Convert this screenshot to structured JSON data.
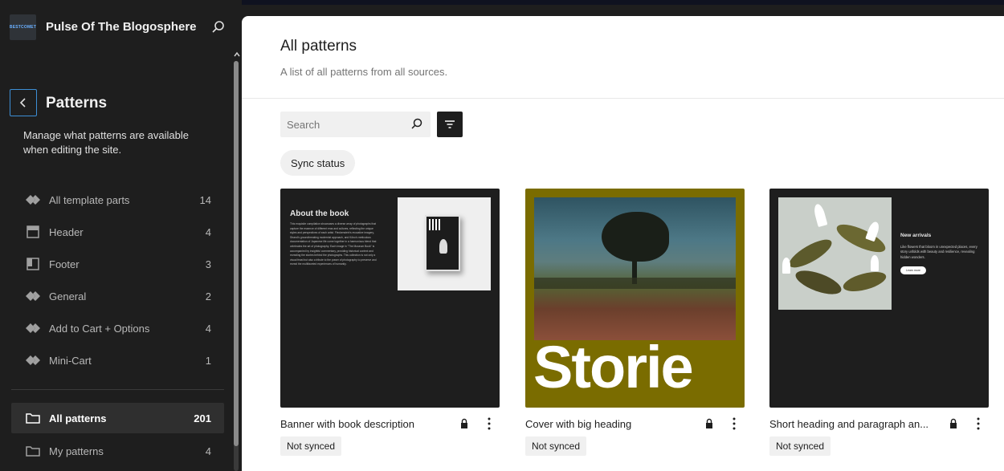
{
  "site": {
    "title": "Pulse Of The Blogosphere",
    "logo_text": "BESTCOMET"
  },
  "sidebar": {
    "heading": "Patterns",
    "description": "Manage what patterns are available when editing the site.",
    "template_parts": [
      {
        "label": "All template parts",
        "count": "14",
        "icon": "diamond-icon"
      },
      {
        "label": "Header",
        "count": "4",
        "icon": "header-layout-icon"
      },
      {
        "label": "Footer",
        "count": "3",
        "icon": "footer-layout-icon"
      },
      {
        "label": "General",
        "count": "2",
        "icon": "diamond-icon"
      },
      {
        "label": "Add to Cart + Options",
        "count": "4",
        "icon": "diamond-icon"
      },
      {
        "label": "Mini-Cart",
        "count": "1",
        "icon": "diamond-icon"
      }
    ],
    "pattern_categories": [
      {
        "label": "All patterns",
        "count": "201",
        "icon": "folder-icon",
        "active": true
      },
      {
        "label": "My patterns",
        "count": "4",
        "icon": "folder-icon",
        "active": false
      }
    ]
  },
  "main": {
    "title": "All patterns",
    "subtitle": "A list of all patterns from all sources.",
    "search": {
      "placeholder": "Search",
      "value": ""
    },
    "filter_chip": "Sync status",
    "patterns": [
      {
        "title": "Banner with book description",
        "status": "Not synced",
        "preview_heading": "About the book",
        "preview_body": "This exquisite compilation showcases a diverse array of photographs that capture the essence of different eras and cultures, reflecting the unique styles and perspectives of each artist. Fleckenstein's evocative imagery, Strand's groundbreaking modernist approach, and Kōno's meticulous documentation of Japanese life come together in a harmonious blend that celebrates the art of photography. Each image in \"The Museum Book\" is accompanied by insightful commentary, providing historical context and revealing the stories behind the photographs. This collection is not only a visual feast but also a tribute to the power of photography to preserve and reveal the multifaceted experiences of humanity."
      },
      {
        "title": "Cover with big heading",
        "status": "Not synced",
        "preview_heading": "Storie"
      },
      {
        "title": "Short heading and paragraph an...",
        "status": "Not synced",
        "preview_heading": "New arrivals",
        "preview_body": "Like flowers that bloom in unexpected places, every story unfolds with beauty and resilience, revealing hidden wonders.",
        "preview_button": "Learn more"
      }
    ]
  },
  "colors": {
    "accent": "#3d8fd6",
    "sidebar_bg": "#1e1e1e",
    "cover_bg": "#7a6c00"
  }
}
